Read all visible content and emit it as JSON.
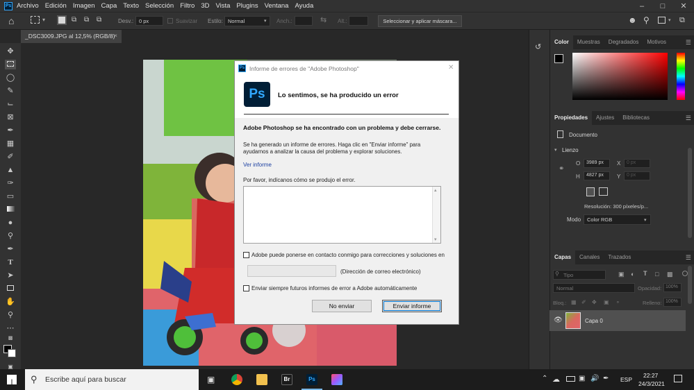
{
  "menubar": {
    "app_icon": "Ps",
    "items": [
      "Archivo",
      "Edición",
      "Imagen",
      "Capa",
      "Texto",
      "Selección",
      "Filtro",
      "3D",
      "Vista",
      "Plugins",
      "Ventana",
      "Ayuda"
    ],
    "window_controls": [
      "minimize-icon",
      "maximize-icon",
      "close-icon"
    ]
  },
  "options": {
    "desv_label": "Desv.:",
    "desv_value": "0 px",
    "suavizar_label": "Suavizar",
    "estilo_label": "Estilo:",
    "estilo_value": "Normal",
    "anch_label": "Anch.:",
    "alt_label": "Alt.:",
    "select_mask_button": "Seleccionar y aplicar máscara..."
  },
  "document_tab": {
    "title": "_DSC3009.JPG al 12,5% (RGB/8)",
    "close": "×"
  },
  "color_panel": {
    "tabs": [
      "Color",
      "Muestras",
      "Degradados",
      "Motivos"
    ]
  },
  "properties_panel": {
    "tabs": [
      "Propiedades",
      "Ajustes",
      "Bibliotecas"
    ],
    "doc_label": "Documento",
    "section": "Lienzo",
    "w_label": "O",
    "w_value": "3989 px",
    "x_label": "X",
    "x_value": "0 px",
    "h_label": "H",
    "h_value": "4827 px",
    "y_label": "Y",
    "y_value": "0 px",
    "resolution": "Resolución: 300 píxeles/p...",
    "mode_label": "Modo",
    "mode_value": "Color RGB"
  },
  "layers_panel": {
    "tabs": [
      "Capas",
      "Canales",
      "Trazados"
    ],
    "filter_placeholder": "Tipo",
    "blend_mode": "Normal",
    "opacity_label": "Opacidad:",
    "opacity_value": "100%",
    "lock_label": "Bloq.:",
    "fill_label": "Relleno:",
    "fill_value": "100%",
    "layers": [
      {
        "name": "Capa 0"
      }
    ]
  },
  "dialog": {
    "title": "Informe de errores de \"Adobe Photoshop\"",
    "heading": "Lo sentimos, se ha producido un error",
    "bold_message": "Adobe Photoshop se ha encontrado con un problema y debe cerrarse.",
    "message": "Se ha generado un informe de errores. Haga clic en \"Enviar informe\" para ayudarnos a analizar la causa del problema y explorar soluciones.",
    "view_report_link": "Ver informe",
    "prompt": "Por favor, indícanos cómo se produjo el error.",
    "contact_checkbox": "Adobe puede ponerse en contacto conmigo para correcciones y soluciones en",
    "email_hint": "(Dirección de correo electrónico)",
    "auto_send_checkbox": "Enviar siempre futuros informes de error a Adobe automáticamente",
    "no_send_button": "No enviar",
    "send_button": "Enviar informe",
    "logo": "Ps"
  },
  "taskbar": {
    "search_placeholder": "Escribe aquí para buscar",
    "language": "ESP",
    "time": "22:27",
    "date": "24/3/2021",
    "br_label": "Br",
    "ps_label": "Ps"
  }
}
